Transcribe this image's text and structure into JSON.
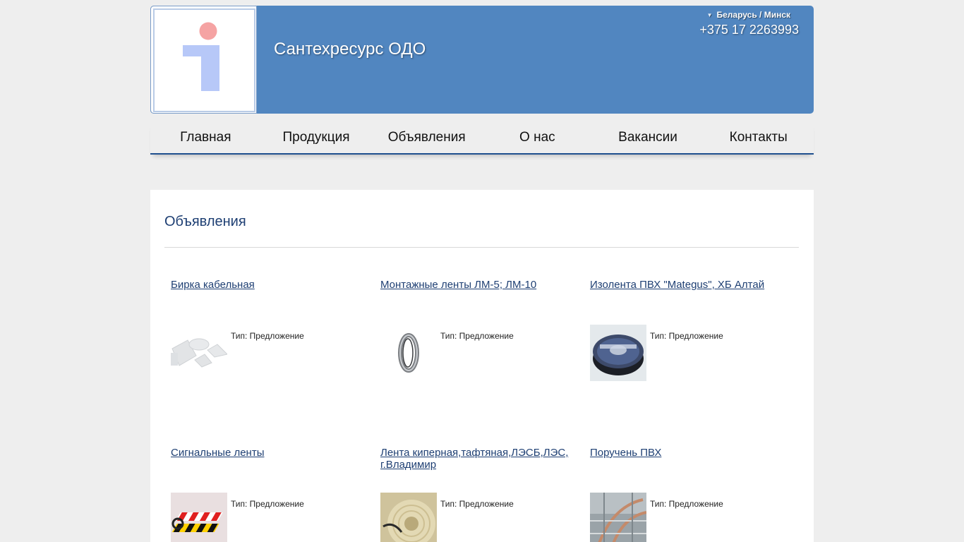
{
  "header": {
    "site_title": "Сантехресурс ОДО",
    "location": "Беларусь / Минск",
    "phone": "+375 17 2263993"
  },
  "nav": {
    "items": [
      {
        "label": "Главная"
      },
      {
        "label": "Продукция"
      },
      {
        "label": "Объявления"
      },
      {
        "label": "О нас"
      },
      {
        "label": "Вакансии"
      },
      {
        "label": "Контакты"
      }
    ]
  },
  "main": {
    "page_title": "Объявления",
    "ads": [
      {
        "title": "Бирка кабельная",
        "type": "Тип: Предложение",
        "image": "cable-tag-image"
      },
      {
        "title": "Монтажные ленты ЛМ-5; ЛМ-10",
        "type": "Тип: Предложение",
        "image": "mounting-tape-image"
      },
      {
        "title": "Изолента ПВХ \"Mategus\", ХБ Алтай",
        "type": "Тип: Предложение",
        "image": "insulating-tape-image"
      },
      {
        "title": "Сигнальные ленты",
        "type": "Тип: Предложение",
        "image": "signal-tape-image"
      },
      {
        "title": "Лента киперная,тафтяная,ЛЭСБ,ЛЭС, г.Владимир",
        "type": "Тип: Предложение",
        "image": "twill-tape-image"
      },
      {
        "title": "Поручень ПВХ",
        "type": "Тип: Предложение",
        "image": "pvc-handrail-image"
      }
    ]
  },
  "colors": {
    "header_bg": "#5186c0",
    "link": "#1e3f73",
    "nav_border": "#1f4f8e",
    "page_bg": "#eeeeee"
  }
}
